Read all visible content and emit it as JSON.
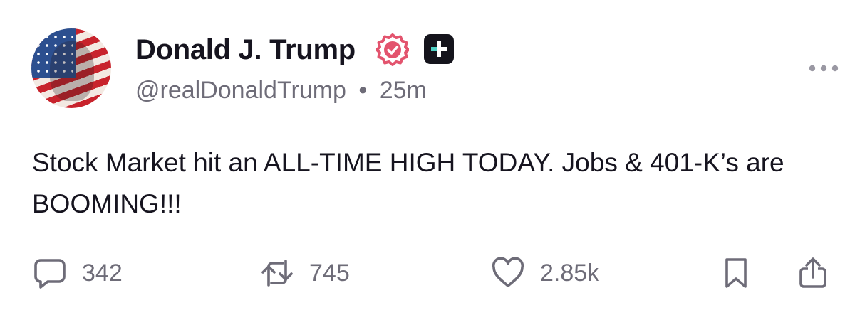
{
  "post": {
    "author_name": "Donald J. Trump",
    "handle": "@realDonaldTrump",
    "separator": "•",
    "time_ago": "25m",
    "text": "Stock Market hit an ALL-TIME HIGH TODAY. Jobs & 401-K’s are BOOMING!!!"
  },
  "actions": {
    "reply_count": "342",
    "repost_count": "745",
    "like_count": "2.85k"
  },
  "icons": {
    "avatar": "avatar",
    "verified": "verified-badge-icon",
    "plus": "plus-badge-icon",
    "more": "more-options-icon",
    "reply": "reply-icon",
    "repost": "repost-icon",
    "like": "heart-icon",
    "bookmark": "bookmark-icon",
    "share": "share-icon"
  },
  "colors": {
    "text": "#16141f",
    "muted": "#6e6c78",
    "verified": "#e3546e",
    "badge_dark": "#15141c",
    "background": "#ffffff"
  }
}
